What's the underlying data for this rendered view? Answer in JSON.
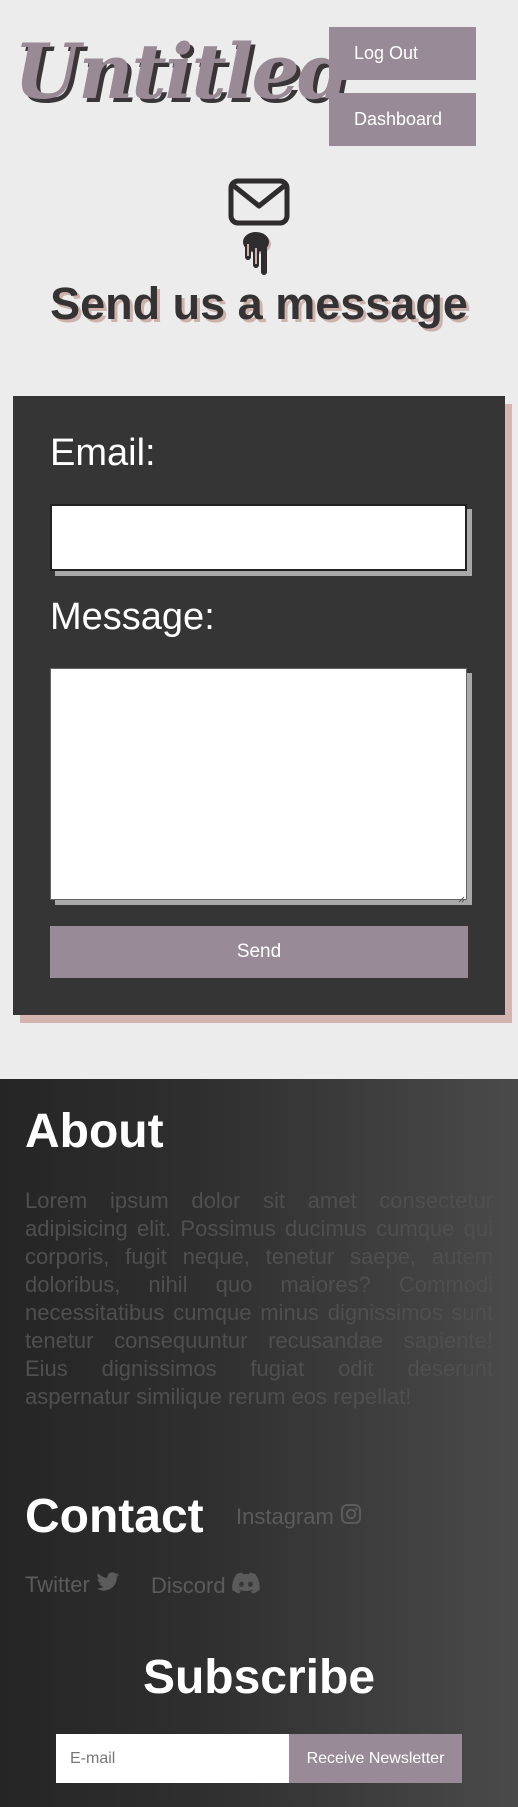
{
  "header": {
    "brand": "Untitled",
    "logout_label": "Log Out",
    "dashboard_label": "Dashboard"
  },
  "hero": {
    "title": "Send us a message",
    "envelope_icon": "envelope-icon",
    "drip_icon": "dripping-hand-icon"
  },
  "form": {
    "email_label": "Email:",
    "email_value": "",
    "message_label": "Message:",
    "message_value": "",
    "send_label": "Send"
  },
  "footer": {
    "about_title": "About",
    "about_text": "Lorem ipsum dolor sit amet consectetur adipisicing elit. Possimus ducimus cumque qui corporis, fugit neque, tenetur saepe, autem doloribus, nihil quo maiores? Commodi necessitatibus cumque minus dignissimos sunt tenetur consequuntur recusandae sapiente! Eius dignissimos fugiat odit deserunt aspernatur similique rerum eos repellat!",
    "contact_title": "Contact",
    "social": {
      "instagram": "Instagram",
      "twitter": "Twitter",
      "discord": "Discord"
    },
    "subscribe_title": "Subscribe",
    "subscribe_placeholder": "E-mail",
    "subscribe_button": "Receive Newsletter"
  },
  "colors": {
    "accent": "#988a96",
    "page_bg": "#ececec",
    "card_bg": "#353535",
    "card_shadow": "#d3b4ae",
    "title_shadow": "#cdb1ab"
  }
}
